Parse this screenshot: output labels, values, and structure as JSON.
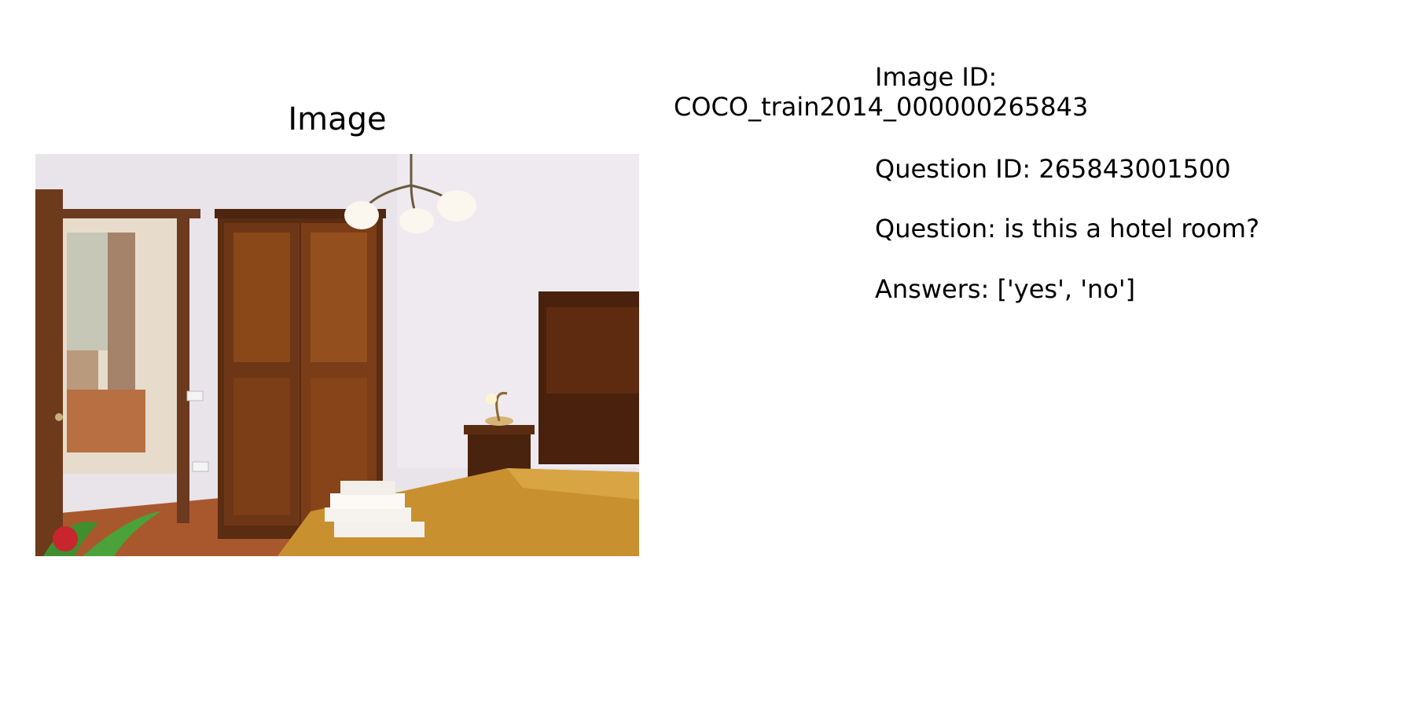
{
  "panel": {
    "title": "Image"
  },
  "photo": {
    "description_icon": "bedroom-photo"
  },
  "info": {
    "image_id_label": "Image ID:",
    "image_id_value": "COCO_train2014_000000265843",
    "question_id_text": "Question ID: 265843001500",
    "question_text": "Question: is this a hotel room?",
    "answers_text": "Answers: ['yes', 'no']"
  }
}
